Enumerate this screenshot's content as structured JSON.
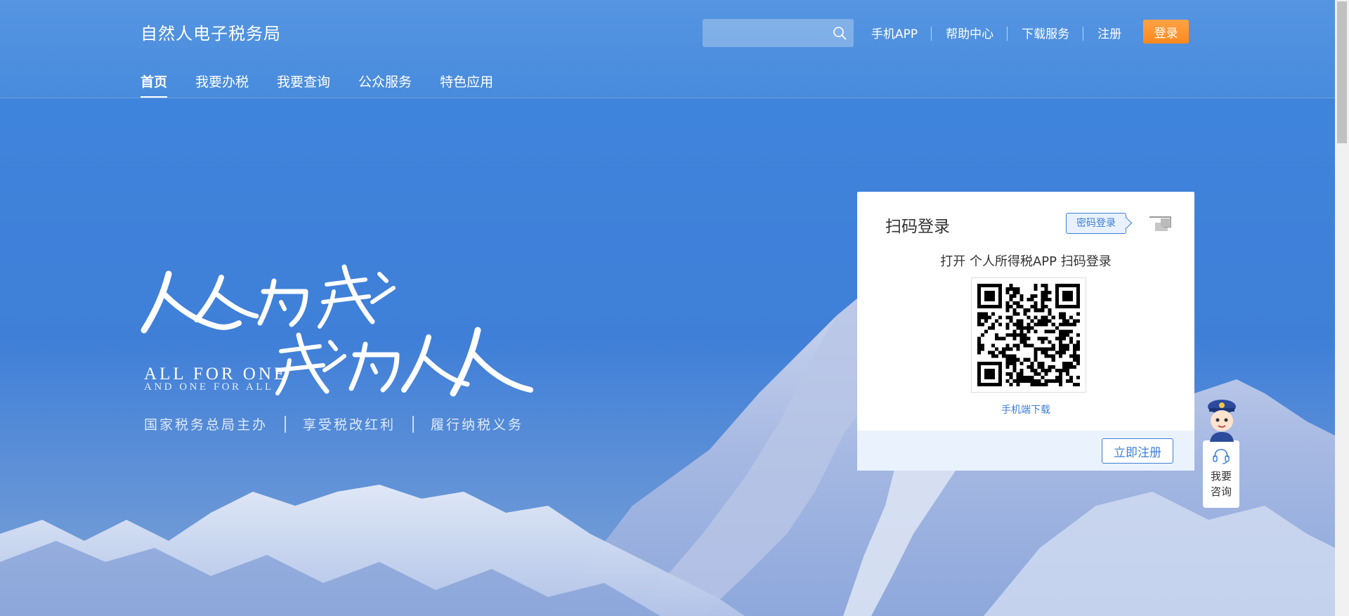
{
  "header": {
    "site_title": "自然人电子税务局",
    "search": {
      "value": "",
      "placeholder": ""
    },
    "top_links": [
      "手机APP",
      "帮助中心",
      "下载服务",
      "注册"
    ],
    "login_label": "登录",
    "tabs": [
      "首页",
      "我要办税",
      "我要查询",
      "公众服务",
      "特色应用"
    ],
    "active_tab": "首页"
  },
  "slogan": {
    "calligraphy_line1": "人人为我",
    "calligraphy_line2": "我为人人",
    "english_line1": "ALL FOR ONE",
    "english_line2": "AND ONE FOR ALL",
    "subline": [
      "国家税务总局主办",
      "享受税改红利",
      "履行纳税义务"
    ]
  },
  "login_card": {
    "title": "扫码登录",
    "password_login_label": "密码登录",
    "scan_hint": "打开 个人所得税APP 扫码登录",
    "app_download": "手机端下载",
    "register_label": "立即注册"
  },
  "consult": {
    "label_line1": "我要",
    "label_line2": "咨询"
  },
  "icons": [
    "search-icon",
    "pc-login-icon",
    "qr-code",
    "mascot-icon",
    "headset-icon"
  ],
  "colors": {
    "brand_blue": "#3d7fd6",
    "login_orange": "#ff8a1d",
    "header_blue": "#5696e2"
  }
}
